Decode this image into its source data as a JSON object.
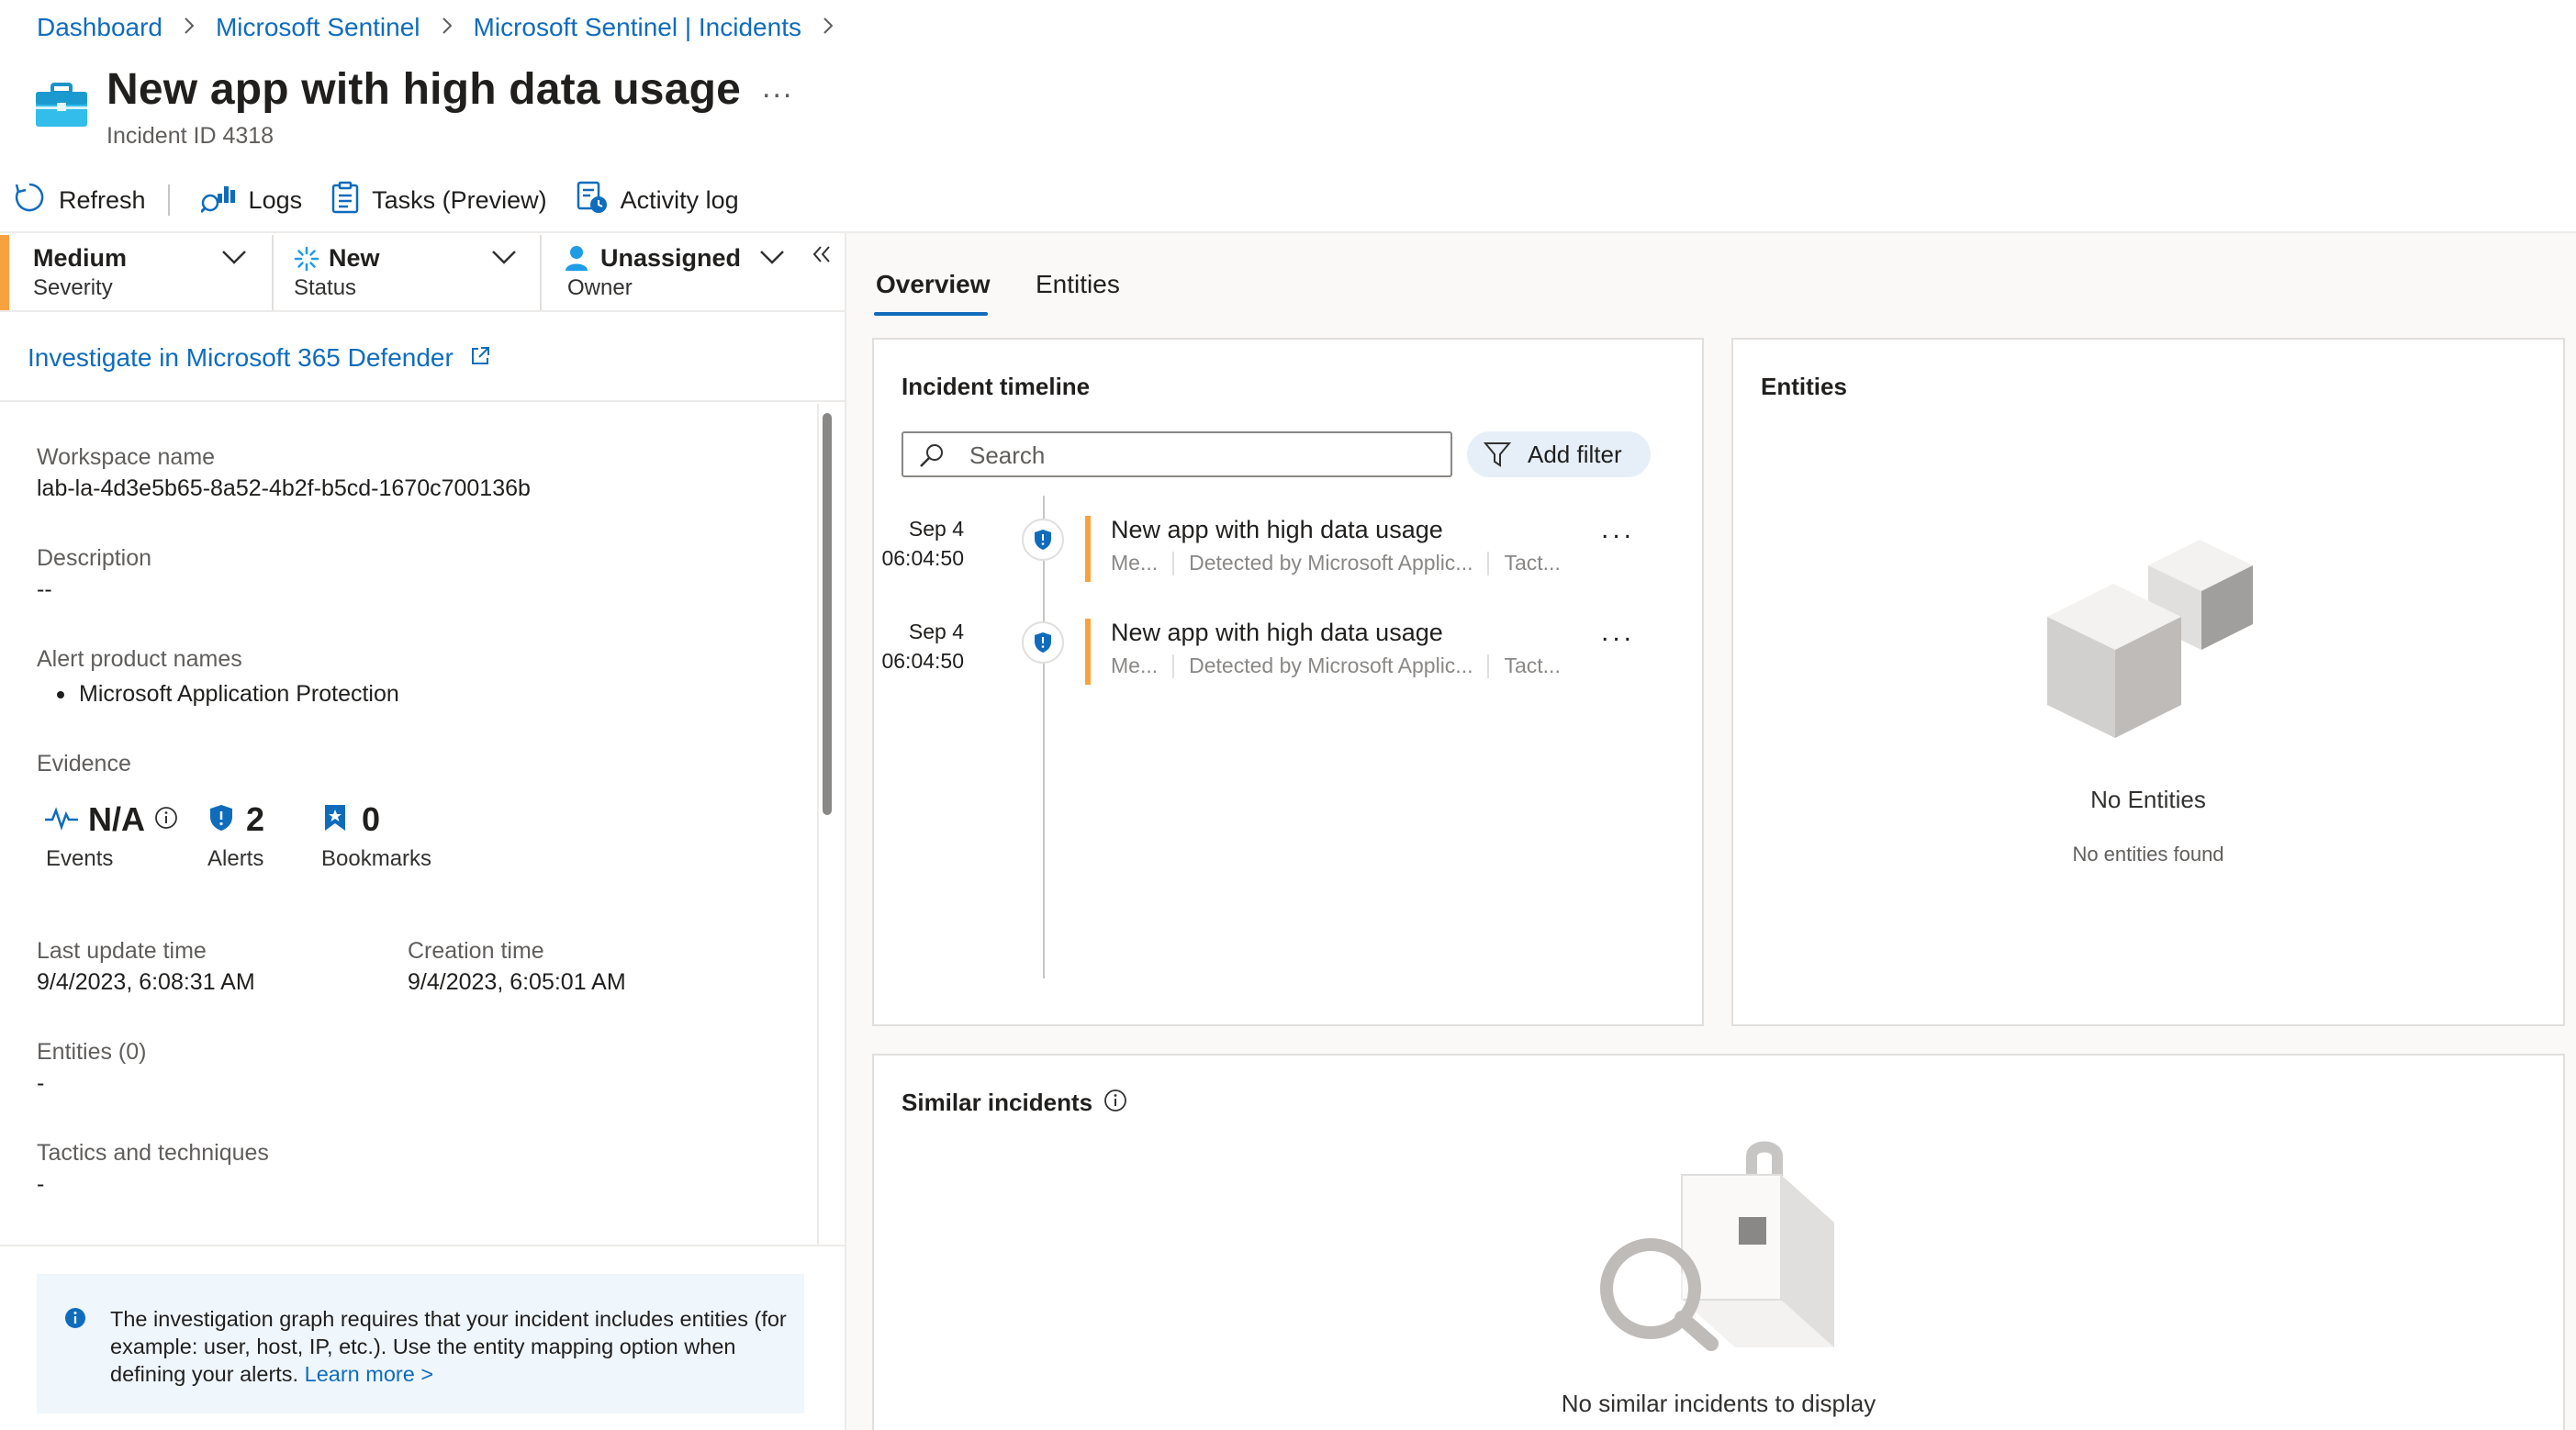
{
  "breadcrumb": [
    {
      "label": "Dashboard"
    },
    {
      "label": "Microsoft Sentinel"
    },
    {
      "label": "Microsoft Sentinel | Incidents"
    }
  ],
  "header": {
    "title": "New app with high data usage",
    "more": "...",
    "incident_id": "Incident ID 4318"
  },
  "toolbar": {
    "refresh": "Refresh",
    "logs": "Logs",
    "tasks": "Tasks (Preview)",
    "activity_log": "Activity log"
  },
  "dropdowns": {
    "severity": {
      "value": "Medium",
      "label": "Severity",
      "color": "#f7a23f"
    },
    "status": {
      "value": "New",
      "label": "Status"
    },
    "owner": {
      "value": "Unassigned",
      "label": "Owner"
    }
  },
  "investigate_link": "Investigate in Microsoft 365 Defender",
  "details": {
    "workspace_label": "Workspace name",
    "workspace_value": "lab-la-4d3e5b65-8a52-4b2f-b5cd-1670c700136b",
    "description_label": "Description",
    "description_value": "--",
    "alert_products_label": "Alert product names",
    "alert_products": [
      "Microsoft Application Protection"
    ],
    "evidence_label": "Evidence",
    "evidence": {
      "events_value": "N/A",
      "events_label": "Events",
      "alerts_value": "2",
      "alerts_label": "Alerts",
      "bookmarks_value": "0",
      "bookmarks_label": "Bookmarks"
    },
    "last_update_label": "Last update time",
    "last_update_value": "9/4/2023, 6:08:31 AM",
    "creation_label": "Creation time",
    "creation_value": "9/4/2023, 6:05:01 AM",
    "entities_label": "Entities (0)",
    "entities_value": "-",
    "tactics_label": "Tactics and techniques",
    "tactics_value": "-"
  },
  "info": {
    "text": "The investigation graph requires that your incident includes entities (for example: user, host, IP, etc.). Use the entity mapping option when defining your alerts.",
    "learn_more": "Learn more >"
  },
  "tabs": [
    {
      "label": "Overview",
      "active": true
    },
    {
      "label": "Entities",
      "active": false
    }
  ],
  "timeline": {
    "title": "Incident timeline",
    "search_placeholder": "Search",
    "add_filter": "Add filter",
    "items": [
      {
        "date": "Sep 4",
        "time": "06:04:50",
        "title": "New app with high data usage",
        "meta1": "Me...",
        "meta2": "Detected by Microsoft Applic...",
        "meta3": "Tact...",
        "more": "..."
      },
      {
        "date": "Sep 4",
        "time": "06:04:50",
        "title": "New app with high data usage",
        "meta1": "Me...",
        "meta2": "Detected by Microsoft Applic...",
        "meta3": "Tact...",
        "more": "..."
      }
    ]
  },
  "entities_card": {
    "title": "Entities",
    "empty_title": "No Entities",
    "empty_sub": "No entities found"
  },
  "similar": {
    "title": "Similar incidents",
    "empty": "No similar incidents to display"
  },
  "colors": {
    "link": "#0f6cbd",
    "severity_medium": "#f7a23f",
    "accent": "#0f6cbd"
  }
}
